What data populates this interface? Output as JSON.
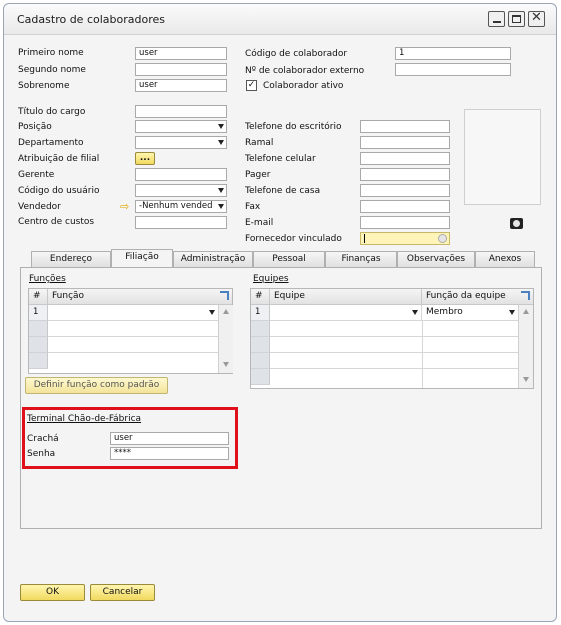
{
  "window": {
    "title": "Cadastro de colaboradores"
  },
  "left_fields": {
    "first_name_label": "Primeiro nome",
    "first_name_value": "user",
    "middle_name_label": "Segundo nome",
    "middle_name_value": "",
    "last_name_label": "Sobrenome",
    "last_name_value": "user",
    "job_title_label": "Título do cargo",
    "job_title_value": "",
    "position_label": "Posição",
    "position_value": "",
    "department_label": "Departamento",
    "department_value": "",
    "branch_label": "Atribuição de filial",
    "branch_button": "...",
    "manager_label": "Gerente",
    "manager_value": "",
    "user_code_label": "Código do usuário",
    "user_code_value": "",
    "salesperson_label": "Vendedor",
    "salesperson_value": "-Nenhum vended",
    "cost_center_label": "Centro de custos",
    "cost_center_value": ""
  },
  "right_fields": {
    "employee_code_label": "Código de colaborador",
    "employee_code_value": "1",
    "external_no_label": "Nº de colaborador externo",
    "external_no_value": "",
    "active_label": "Colaborador ativo",
    "active_checked": "✓",
    "office_phone_label": "Telefone do escritório",
    "extension_label": "Ramal",
    "mobile_label": "Telefone celular",
    "pager_label": "Pager",
    "home_phone_label": "Telefone de casa",
    "fax_label": "Fax",
    "email_label": "E-mail",
    "linked_vendor_label": "Fornecedor vinculado"
  },
  "tabs": [
    {
      "label": "Endereço",
      "active": false
    },
    {
      "label": "Filiação",
      "active": true
    },
    {
      "label": "Administração",
      "active": false
    },
    {
      "label": "Pessoal",
      "active": false
    },
    {
      "label": "Finanças",
      "active": false
    },
    {
      "label": "Observações",
      "active": false
    },
    {
      "label": "Anexos",
      "active": false
    }
  ],
  "functions_section": {
    "title": "Funções",
    "columns": [
      "#",
      "Função"
    ],
    "rows": [
      {
        "num": "1",
        "value": ""
      }
    ],
    "set_default_button": "Definir função como padrão"
  },
  "teams_section": {
    "title": "Equipes",
    "columns": [
      "#",
      "Equipe",
      "Função da equipe"
    ],
    "rows": [
      {
        "num": "1",
        "team": "",
        "role": "Membro"
      }
    ]
  },
  "shop_floor": {
    "title": "Terminal Chão-de-Fábrica",
    "badge_label": "Crachá",
    "badge_value": "user",
    "password_label": "Senha",
    "password_value": "****",
    "highlight_color": "#e0101a"
  },
  "footer": {
    "ok_label": "OK",
    "cancel_label": "Cancelar"
  },
  "colors": {
    "accent_button": "#f1d95f",
    "vendor_field": "#fff4b8"
  }
}
